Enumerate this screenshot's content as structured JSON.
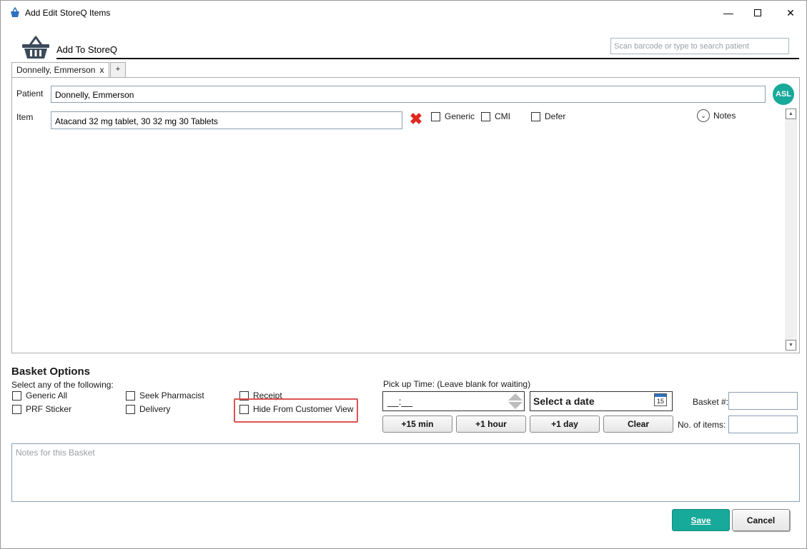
{
  "window": {
    "title": "Add Edit StoreQ Items",
    "minimize_glyph": "—",
    "close_glyph": "✕"
  },
  "header": {
    "title": "Add To StoreQ",
    "search_placeholder": "Scan barcode or type to search patient"
  },
  "tabs": [
    {
      "label": "Donnelly, Emmerson",
      "close": "x"
    },
    {
      "label": "+"
    }
  ],
  "form": {
    "patient_label": "Patient",
    "patient_value": "Donnelly, Emmerson",
    "avatar_initials": "ASL",
    "item_label": "Item",
    "item_value": "Atacand 32 mg tablet, 30 32 mg 30 Tablets",
    "remove_glyph": "✖",
    "checkboxes": [
      "Generic",
      "CMI",
      "Defer"
    ],
    "notes_toggle": "Notes",
    "notes_toggle_glyph": "⌄"
  },
  "basket": {
    "title": "Basket Options",
    "subtitle": "Select any of the following:",
    "options": {
      "generic_all": "Generic All",
      "prf_sticker": "PRF Sticker",
      "seek_pharmacist": "Seek Pharmacist",
      "delivery": "Delivery",
      "receipt": "Receipt",
      "hide_from_customer_view": "Hide From Customer View"
    },
    "pickup_label": "Pick up Time: (Leave blank for waiting)",
    "time_value": "__:__",
    "date_value": "Select a date",
    "calendar_day": "15",
    "quick_buttons": [
      "+15 min",
      "+1 hour",
      "+1 day",
      "Clear"
    ],
    "basket_num_label": "Basket #:",
    "items_label": "No. of items:",
    "notes_placeholder": "Notes for this Basket"
  },
  "actions": {
    "save": "Save",
    "cancel": "Cancel"
  },
  "colors": {
    "accent": "#17a99a",
    "danger": "#e0281e",
    "highlight": "#e05252"
  }
}
